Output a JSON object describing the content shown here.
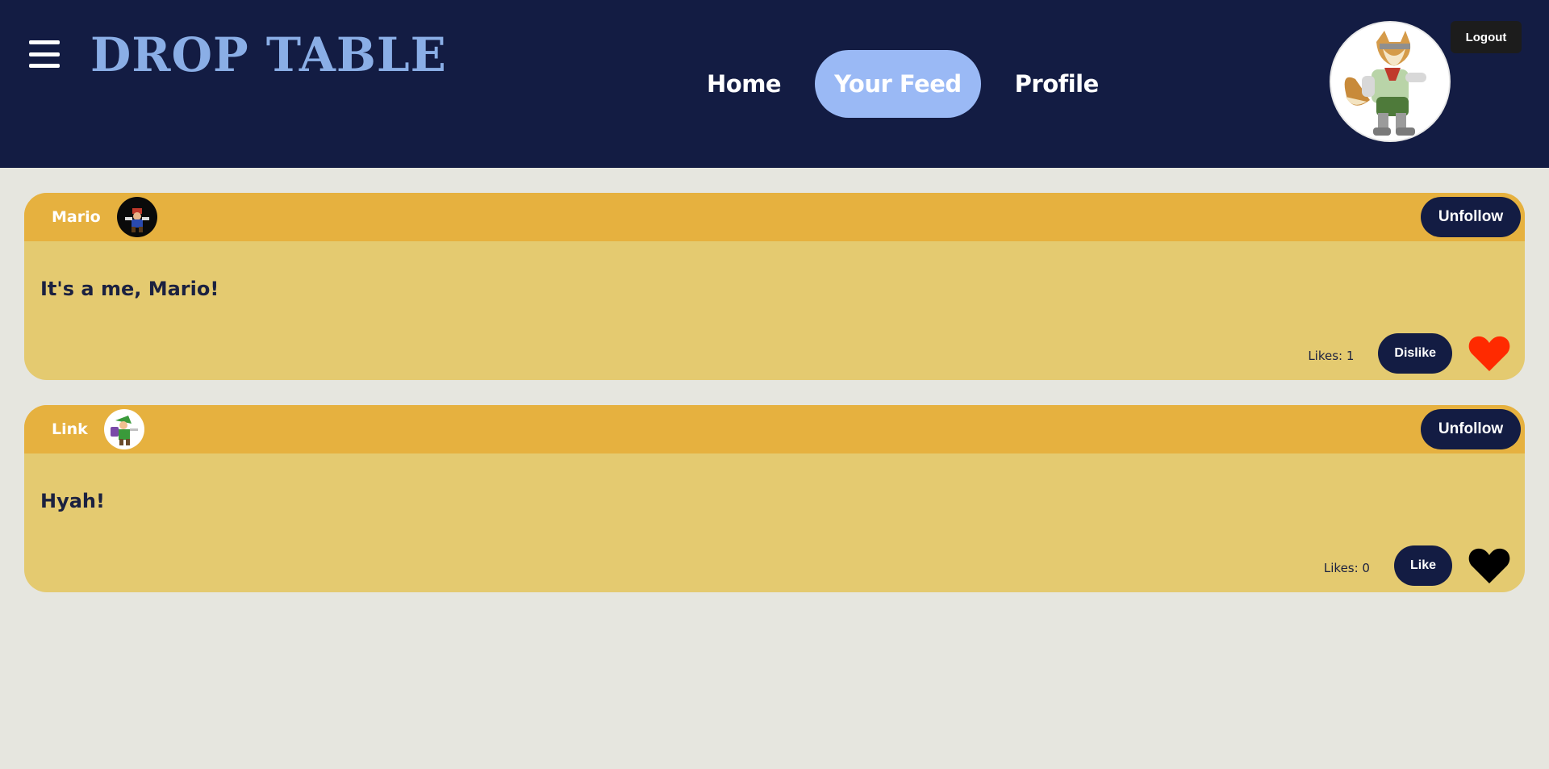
{
  "header": {
    "brand": "DROP TABLE",
    "nav": [
      {
        "label": "Home",
        "active": false
      },
      {
        "label": "Your Feed",
        "active": true
      },
      {
        "label": "Profile",
        "active": false
      }
    ],
    "logout_label": "Logout"
  },
  "posts": [
    {
      "username": "Mario",
      "unfollow_label": "Unfollow",
      "text": "It's a me, Mario!",
      "likes_text": "Likes: 1",
      "action_label": "Dislike",
      "liked": true
    },
    {
      "username": "Link",
      "unfollow_label": "Unfollow",
      "text": "Hyah!",
      "likes_text": "Likes: 0",
      "action_label": "Like",
      "liked": false
    }
  ],
  "colors": {
    "header_bg": "#131c43",
    "brand": "#8aaee6",
    "nav_active": "#9ab9f5",
    "post_head": "#e6b13f",
    "post_body": "#e4ca70",
    "page_bg": "#e6e6df",
    "heart_liked": "#ff2a00",
    "heart_unliked": "#000000"
  }
}
